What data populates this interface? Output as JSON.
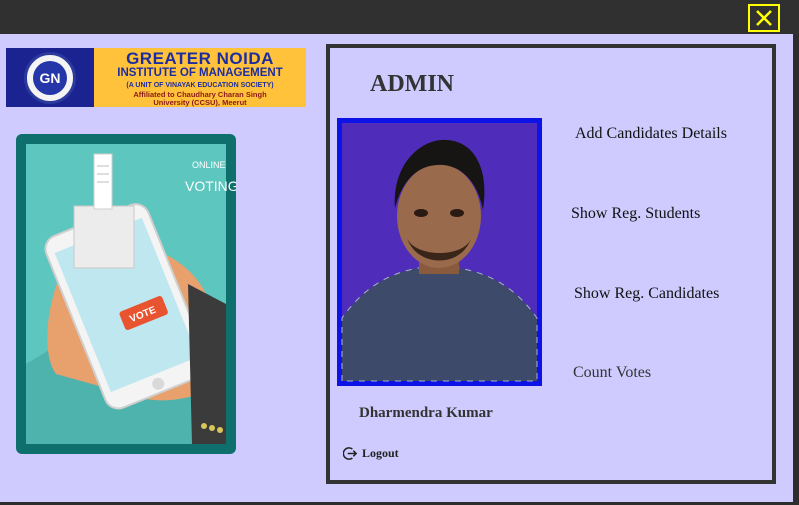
{
  "window": {
    "close_icon": "close-icon",
    "accent": "#ffff00"
  },
  "logo": {
    "badge_text": "GN",
    "name": "GREATER NOIDA",
    "line2": "INSTITUTE OF MANAGEMENT",
    "line3": "(A UNIT OF VINAYAK EDUCATION SOCIETY)",
    "line4": "Affiliated to Chaudhary Charan Singh",
    "line5": "University (CCSU), Meerut"
  },
  "illustration": {
    "line1": "ONLINE",
    "line2": "VOTING",
    "vote_tag": "VOTE"
  },
  "admin": {
    "title": "ADMIN",
    "name": "Dharmendra Kumar",
    "logout_label": "Logout"
  },
  "menu": {
    "add_candidates": "Add Candidates Details",
    "show_students": "Show Reg. Students",
    "show_candidates": "Show Reg. Candidates",
    "count_votes": "Count Votes"
  },
  "colors": {
    "background": "#cfcbff",
    "photo_border": "#0d13e6",
    "titlebar": "#303030"
  }
}
